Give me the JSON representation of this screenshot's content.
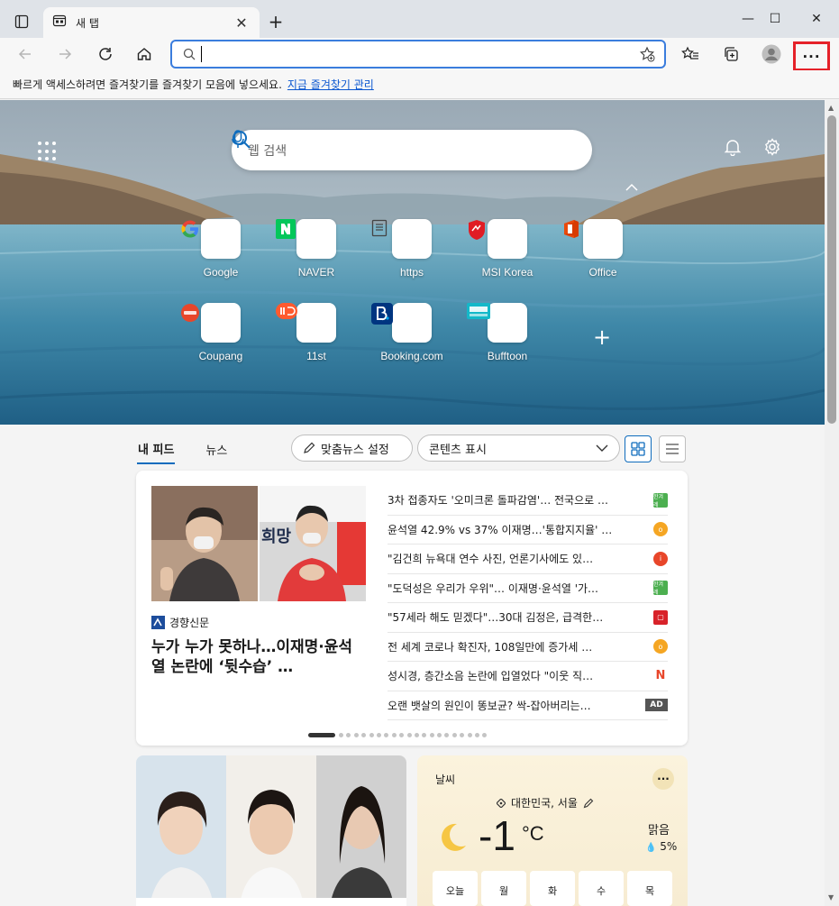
{
  "tab": {
    "title": "새 탭",
    "close": "✕"
  },
  "window": {
    "new_tab": "+",
    "minimize": "—",
    "maximize": "☐",
    "close": "✕"
  },
  "address": {
    "value": "",
    "placeholder": ""
  },
  "toolbar": {
    "more_label": "···"
  },
  "favorites_bar": {
    "message": "빠르게 액세스하려면 즐겨찾기를 즐겨찾기 모음에 넣으세요.",
    "link": "지금 즐겨찾기 관리"
  },
  "hero": {
    "search_placeholder": "웹 검색"
  },
  "quick_links": [
    {
      "label": "Google"
    },
    {
      "label": "NAVER"
    },
    {
      "label": "https"
    },
    {
      "label": "MSI Korea"
    },
    {
      "label": "Office"
    },
    {
      "label": "Coupang"
    },
    {
      "label": "11st"
    },
    {
      "label": "Booking.com"
    },
    {
      "label": "Bufftoon"
    }
  ],
  "feed": {
    "tabs": [
      {
        "label": "내 피드"
      },
      {
        "label": "뉴스"
      }
    ],
    "personalize_label": "맞춤뉴스 설정",
    "content_display_label": "콘텐츠 표시"
  },
  "news": {
    "publisher": "경향신문",
    "headline": "누가 누가 못하나…이재명·윤석열 논란에 ‘뒷수습’ …",
    "image_sign_text": "희망",
    "items": [
      {
        "title": "3차 접종자도 '오미크론 돌파감염'… 전국으로 …",
        "source_color": "#4caf50",
        "source_text": "한겨레"
      },
      {
        "title": "윤석열 42.9% vs 37% 이재명…'통합지지율' …",
        "source_color": "#f5a623",
        "source_text": "o"
      },
      {
        "title": "\"김건희 뉴욕대 연수 사진, 언론기사에도 있…",
        "source_color": "#e8462a",
        "source_text": "i"
      },
      {
        "title": "\"도덕성은 우리가 우위\"… 이재명·윤석열 '가…",
        "source_color": "#4caf50",
        "source_text": "한겨레"
      },
      {
        "title": "\"57세라 해도 믿겠다\"…30대 김정은, 급격한…",
        "source_color": "#d8232a",
        "source_text": "▢"
      },
      {
        "title": "전 세계 코로나 확진자, 108일만에 증가세 …",
        "source_color": "#f5a623",
        "source_text": "o"
      },
      {
        "title": "성시경, 층간소음 논란에 입열었다 \"이웃 직…",
        "source_color": "#ffffff",
        "source_text": "N"
      },
      {
        "title": "오랜 뱃살의 원인이 똥보균? 싹-잡아버리는…",
        "ad": "AD"
      }
    ]
  },
  "weather": {
    "title": "날씨",
    "more": "···",
    "location": "대한민국, 서울",
    "temp": "-1",
    "unit": "°C",
    "condition": "맑음",
    "precip": "5%",
    "days": [
      {
        "label": "오늘"
      },
      {
        "label": "월"
      },
      {
        "label": "화"
      },
      {
        "label": "수"
      },
      {
        "label": "목"
      }
    ]
  },
  "colors": {
    "accent": "#0f6cbd",
    "highlight": "#e52129"
  }
}
